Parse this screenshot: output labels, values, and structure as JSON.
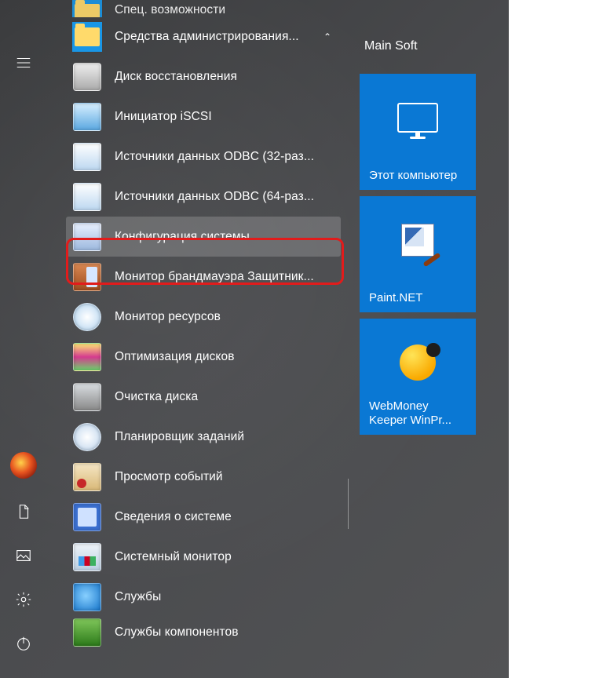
{
  "rail": {
    "hamburger": "menu-icon",
    "avatar": "user-avatar",
    "documents": "documents-icon",
    "pictures": "pictures-icon",
    "settings": "settings-icon",
    "power": "power-icon"
  },
  "applist": {
    "top_truncated": "Спец. возможности",
    "folder_label": "Средства администрирования...",
    "items": [
      {
        "label": "Диск восстановления",
        "icon": "disk"
      },
      {
        "label": "Инициатор iSCSI",
        "icon": "iscsi"
      },
      {
        "label": "Источники данных ODBC (32-раз...",
        "icon": "odbc"
      },
      {
        "label": "Источники данных ODBC (64-раз...",
        "icon": "odbc"
      },
      {
        "label": "Конфигурация системы",
        "icon": "msc",
        "highlight": true
      },
      {
        "label": "Монитор брандмауэра Защитник...",
        "icon": "fw"
      },
      {
        "label": "Монитор ресурсов",
        "icon": "rm"
      },
      {
        "label": "Оптимизация дисков",
        "icon": "opt"
      },
      {
        "label": "Очистка диска",
        "icon": "clean"
      },
      {
        "label": "Планировщик заданий",
        "icon": "sched"
      },
      {
        "label": "Просмотр событий",
        "icon": "ev"
      },
      {
        "label": "Сведения о системе",
        "icon": "sys"
      },
      {
        "label": "Системный монитор",
        "icon": "perf"
      },
      {
        "label": "Службы",
        "icon": "svc"
      },
      {
        "label": "Службы компонентов",
        "icon": "comp"
      }
    ]
  },
  "tiles": {
    "heading": "Main Soft",
    "list": [
      {
        "label": "Этот компьютер",
        "icon": "pc"
      },
      {
        "label": "Paint.NET",
        "icon": "paint"
      },
      {
        "label": "WebMoney Keeper WinPr...",
        "icon": "wm"
      }
    ]
  }
}
